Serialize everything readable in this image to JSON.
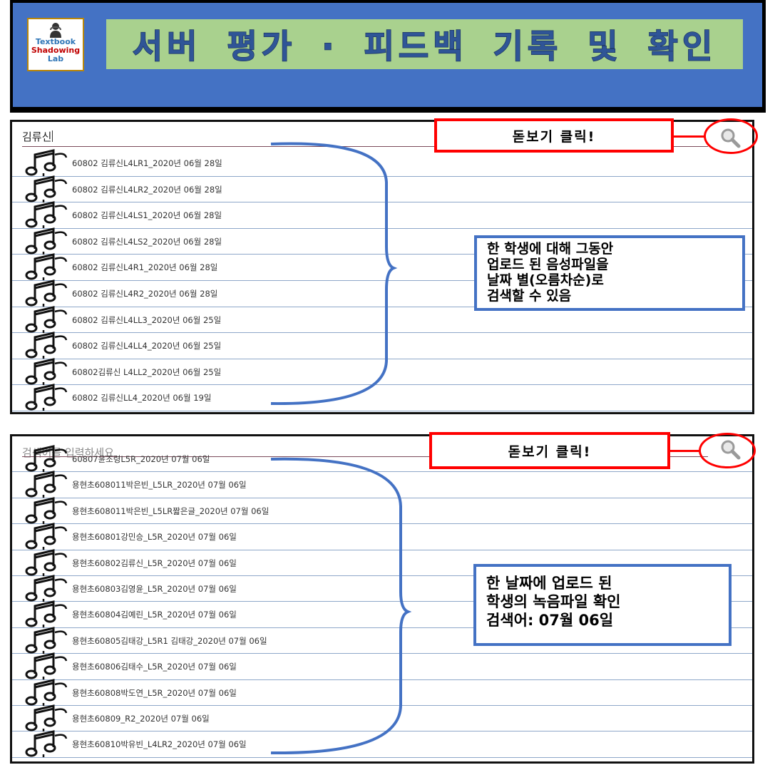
{
  "header": {
    "logo_lines": [
      "Textbook",
      "Shadowing",
      "Lab"
    ],
    "title": "서버 평가 · 피드백 기록 및 확인"
  },
  "panel1": {
    "search_value": "김류신",
    "search_callout": "돋보기 클릭!",
    "search_icon": "magnifier-icon",
    "items": [
      "60802 김류신L4LR1_2020년 06월 28일",
      "60802 김류신L4LR2_2020년 06월 28일",
      "60802 김류신L4LS1_2020년 06월 28일",
      "60802 김류신L4LS2_2020년 06월 28일",
      "60802 김류신L4R1_2020년 06월 28일",
      "60802 김류신L4R2_2020년 06월 28일",
      "60802 김류신L4LL3_2020년 06월 25일",
      "60802 김류신L4LL4_2020년 06월 25일",
      "60802김류신 L4LL2_2020년 06월 25일",
      "60802 김류신LL4_2020년 06월 19일"
    ],
    "callout_lines": [
      "한 학생에 대해  그동안",
      "업로드 된 음성파일을",
      "날짜 별(오름차순)로",
      "검색할 수 있음"
    ]
  },
  "panel2": {
    "search_placeholder": "검색어를 입력하세요",
    "search_callout": "돋보기 클릭!",
    "search_icon": "magnifier-icon",
    "items": [
      "60807윤조령L5R_2020년 07월 06일",
      "용현초608011박은빈_L5LR_2020년 07월 06일",
      "용현초608011박은빈_L5LR짧은글_2020년 07월 06일",
      "용현초60801강민승_L5R_2020년 07월 06일",
      "용현초60802김류신_L5R_2020년 07월 06일",
      "용현초60803김영윤_L5R_2020년 07월 06일",
      "용현초60804김예린_L5R_2020년 07월 06일",
      "용현초60805김태강_L5R1 김태강_2020년 07월 06일",
      "용현초60806김태수_L5R_2020년 07월 06일",
      "용현초60808박도연_L5R_2020년 07월 06일",
      "용현초60809_R2_2020년 07월 06일",
      "용현초60810박유빈_L4LR2_2020년 07월 06일"
    ],
    "callout_lines": [
      "한 날짜에 업로드 된",
      "학생의 녹음파일 확인",
      "검색어: 07월 06일"
    ]
  },
  "colors": {
    "banner_bg": "#4472c4",
    "title_bg": "#a9d18e",
    "callout_red": "#ff0000",
    "callout_blue": "#4472c4",
    "row_divider": "#8ea7c9"
  },
  "icons": [
    "music-note-icon",
    "magnifier-icon",
    "student-avatar-icon"
  ]
}
